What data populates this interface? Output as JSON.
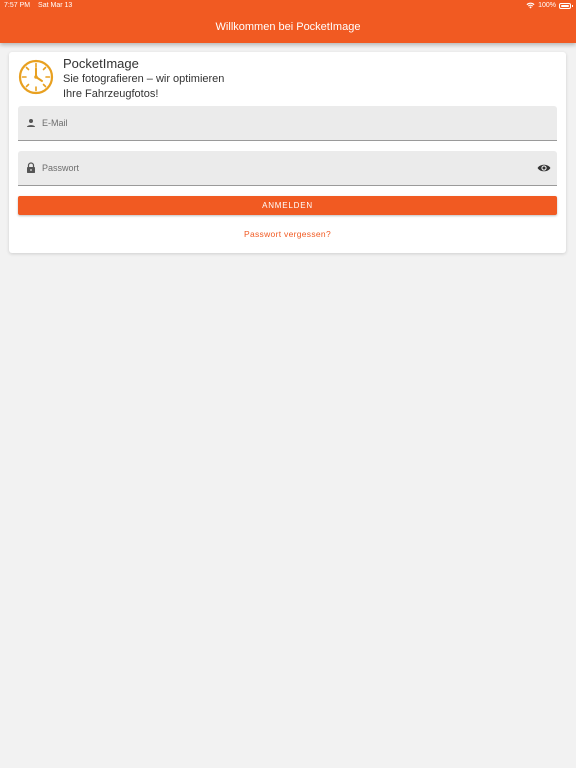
{
  "status_bar": {
    "time": "7:57 PM",
    "date": "Sat Mar 13",
    "battery": "100%"
  },
  "app_bar": {
    "title": "Willkommen bei PocketImage"
  },
  "brand": {
    "name": "PocketImage",
    "tagline": "Sie fotografieren – wir optimieren\nIhre Fahrzeugfotos!",
    "logo_color": "#e8a020"
  },
  "form": {
    "email": {
      "placeholder": "E-Mail",
      "value": "",
      "icon": "person-icon"
    },
    "password": {
      "placeholder": "Passwort",
      "value": "",
      "icon": "lock-icon",
      "toggle_icon": "eye-icon"
    },
    "login_label": "ANMELDEN",
    "forgot_label": "Passwort vergessen?"
  },
  "colors": {
    "accent": "#f15a22",
    "background": "#f2f2f2",
    "field_bg": "#ebebeb"
  }
}
